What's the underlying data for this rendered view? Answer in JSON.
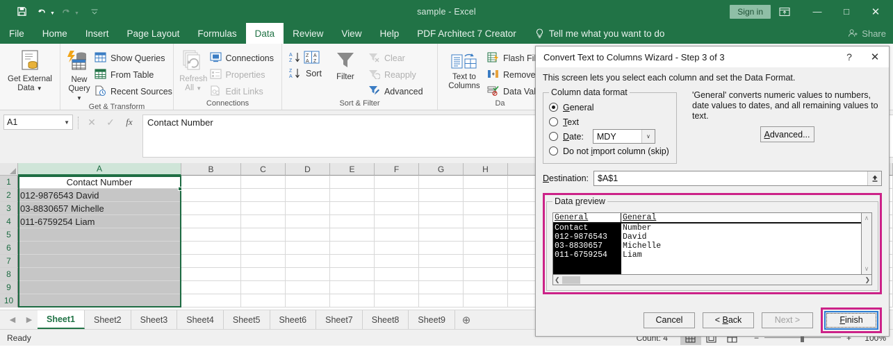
{
  "titlebar": {
    "document_title": "sample  -  Excel",
    "signin_label": "Sign in",
    "qat": [
      {
        "name": "save-icon",
        "label": "save"
      },
      {
        "name": "undo-icon",
        "label": "undo"
      },
      {
        "name": "redo-icon",
        "label": "redo"
      },
      {
        "name": "customize-qat-icon",
        "label": "customize"
      }
    ],
    "window_buttons": {
      "ribbon_display": "ribbon-display-options",
      "minimize": "—",
      "maximize": "□",
      "close": "✕"
    }
  },
  "ribbon_tabs": [
    {
      "label": "File",
      "active": false
    },
    {
      "label": "Home",
      "active": false
    },
    {
      "label": "Insert",
      "active": false
    },
    {
      "label": "Page Layout",
      "active": false
    },
    {
      "label": "Formulas",
      "active": false
    },
    {
      "label": "Data",
      "active": true
    },
    {
      "label": "Review",
      "active": false
    },
    {
      "label": "View",
      "active": false
    },
    {
      "label": "Help",
      "active": false
    },
    {
      "label": "PDF Architect 7 Creator",
      "active": false
    }
  ],
  "tellme": {
    "placeholder": "Tell me what you want to do"
  },
  "share": {
    "label": "Share"
  },
  "ribbon": {
    "groups": [
      {
        "name": "get-external-data",
        "label": "",
        "big_button": {
          "line1": "Get External",
          "line2": "Data",
          "has_dropdown": true
        }
      },
      {
        "name": "get-and-transform",
        "label": "Get & Transform",
        "big_button": {
          "line1": "New",
          "line2": "Query",
          "has_dropdown": true
        },
        "items": [
          {
            "label": "Show Queries",
            "disabled": false
          },
          {
            "label": "From Table",
            "disabled": false
          },
          {
            "label": "Recent Sources",
            "disabled": false
          }
        ]
      },
      {
        "name": "connections",
        "label": "Connections",
        "big_button": {
          "line1": "Refresh",
          "line2": "All",
          "has_dropdown": true,
          "disabled": true
        },
        "items": [
          {
            "label": "Connections",
            "disabled": false
          },
          {
            "label": "Properties",
            "disabled": true
          },
          {
            "label": "Edit Links",
            "disabled": true
          }
        ]
      },
      {
        "name": "sort-and-filter",
        "label": "Sort & Filter",
        "sort_label": "Sort",
        "filter_label": "Filter",
        "items": [
          {
            "label": "Clear",
            "disabled": true
          },
          {
            "label": "Reapply",
            "disabled": true
          },
          {
            "label": "Advanced",
            "disabled": false
          }
        ]
      },
      {
        "name": "data-tools",
        "label": "Da",
        "big_button": {
          "line1": "Text to",
          "line2": "Columns"
        },
        "items": [
          {
            "label": "Flash Fill",
            "disabled": false
          },
          {
            "label": "Remove Dup",
            "disabled": false
          },
          {
            "label": "Data Validati",
            "disabled": false
          }
        ]
      }
    ]
  },
  "formula_bar": {
    "name_box_value": "A1",
    "cancel_icon": "✕",
    "enter_icon": "✓",
    "function_icon": "fx",
    "formula_value": "Contact Number"
  },
  "grid": {
    "columns": [
      "A",
      "B",
      "C",
      "D",
      "E",
      "F",
      "G",
      "H"
    ],
    "selected_column": "A",
    "rows": [
      "1",
      "2",
      "3",
      "4",
      "5",
      "6",
      "7",
      "8",
      "9",
      "10"
    ],
    "column_a_values": [
      "Contact Number",
      "012-9876543 David",
      "03-8830657 Michelle",
      "011-6759254 Liam",
      "",
      "",
      "",
      "",
      "",
      ""
    ],
    "active_cell": "A1"
  },
  "sheet_tabs": {
    "tabs": [
      "Sheet1",
      "Sheet2",
      "Sheet3",
      "Sheet4",
      "Sheet5",
      "Sheet6",
      "Sheet7",
      "Sheet8",
      "Sheet9"
    ],
    "active": "Sheet1",
    "add_label": "⊕",
    "prev_arrow": "◀",
    "next_arrow": "▶"
  },
  "status_bar": {
    "state": "Ready",
    "count": "Count: 4",
    "views": [
      "normal-view",
      "page-layout-view",
      "page-break-preview"
    ],
    "active_view": "normal-view",
    "zoom_out": "−",
    "zoom_in": "+",
    "zoom_level": "100%"
  },
  "dialog": {
    "title": "Convert Text to Columns Wizard - Step 3 of 3",
    "help_icon": "?",
    "close_icon": "✕",
    "intro": "This screen lets you select each column and set the Data Format.",
    "column_data_format": {
      "legend": "Column data format",
      "options": [
        {
          "label": "General",
          "underline_index": 0,
          "selected": true
        },
        {
          "label": "Text",
          "underline_index": 0,
          "selected": false
        },
        {
          "label": "Date:",
          "underline_index": 0,
          "selected": false
        },
        {
          "label": "Do not import column (skip)",
          "underline_index": 7,
          "selected": false
        }
      ],
      "date_format_value": "MDY",
      "date_format_arrow": "∨"
    },
    "description": "'General' converts numeric values to numbers, date values to dates, and all remaining values to text.",
    "advanced_label": "Advanced...",
    "destination": {
      "label": "Destination:",
      "value": "$A$1",
      "picker_icon": "⬆"
    },
    "data_preview": {
      "legend": "Data preview",
      "headers": [
        "General",
        "General"
      ],
      "rows": [
        [
          "Contact",
          "Number"
        ],
        [
          "012-9876543",
          "David"
        ],
        [
          "03-8830657",
          "Michelle"
        ],
        [
          "011-6759254",
          "Liam"
        ]
      ],
      "selected_column_index": 0,
      "scroll_left_icon": "❮",
      "scroll_right_icon": "❯",
      "scroll_up_icon": "∧",
      "scroll_down_icon": "∨"
    },
    "buttons": {
      "cancel": "Cancel",
      "back": "< Back",
      "next": "Next >",
      "finish": "Finish",
      "next_disabled": true,
      "finish_focused": true
    },
    "highlight_color": "#cc2288",
    "focus_color": "#2b7cd3"
  },
  "theme": {
    "excel_green": "#217346",
    "ribbon_bg": "#f7f7f7",
    "selection_green": "#1d6b42"
  }
}
